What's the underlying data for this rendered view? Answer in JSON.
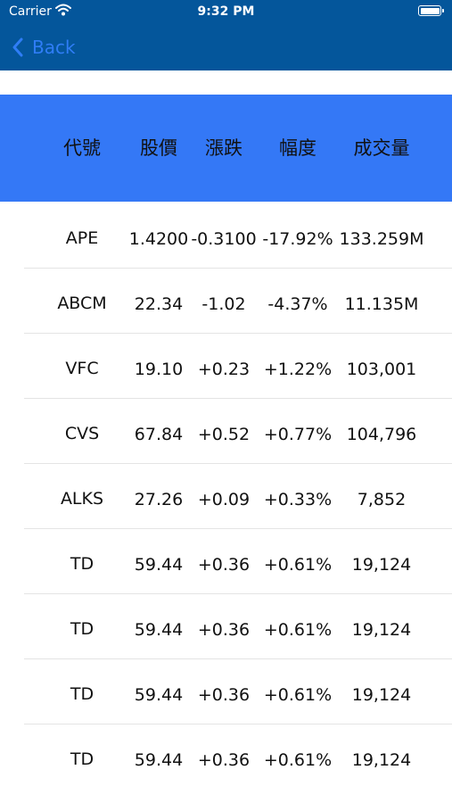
{
  "status_bar": {
    "carrier": "Carrier",
    "time": "9:32 PM"
  },
  "nav": {
    "back_label": "Back"
  },
  "table": {
    "headers": [
      "代號",
      "股價",
      "漲跌",
      "幅度",
      "成交量"
    ],
    "rows": [
      [
        "APE",
        "1.4200",
        "-0.3100",
        "-17.92%",
        "133.259M"
      ],
      [
        "ABCM",
        "22.34",
        "-1.02",
        "-4.37%",
        "11.135M"
      ],
      [
        "VFC",
        "19.10",
        "+0.23",
        "+1.22%",
        "103,001"
      ],
      [
        "CVS",
        "67.84",
        "+0.52",
        "+0.77%",
        "104,796"
      ],
      [
        "ALKS",
        "27.26",
        "+0.09",
        "+0.33%",
        "7,852"
      ],
      [
        "TD",
        "59.44",
        "+0.36",
        "+0.61%",
        "19,124"
      ],
      [
        "TD",
        "59.44",
        "+0.36",
        "+0.61%",
        "19,124"
      ],
      [
        "TD",
        "59.44",
        "+0.36",
        "+0.61%",
        "19,124"
      ],
      [
        "TD",
        "59.44",
        "+0.36",
        "+0.61%",
        "19,124"
      ]
    ]
  },
  "colors": {
    "nav_bar": "#04569b",
    "header_bar": "#3478f6",
    "back_link": "#2f7df6"
  },
  "icons": [
    "wifi-icon",
    "battery-icon",
    "chevron-left-icon"
  ]
}
